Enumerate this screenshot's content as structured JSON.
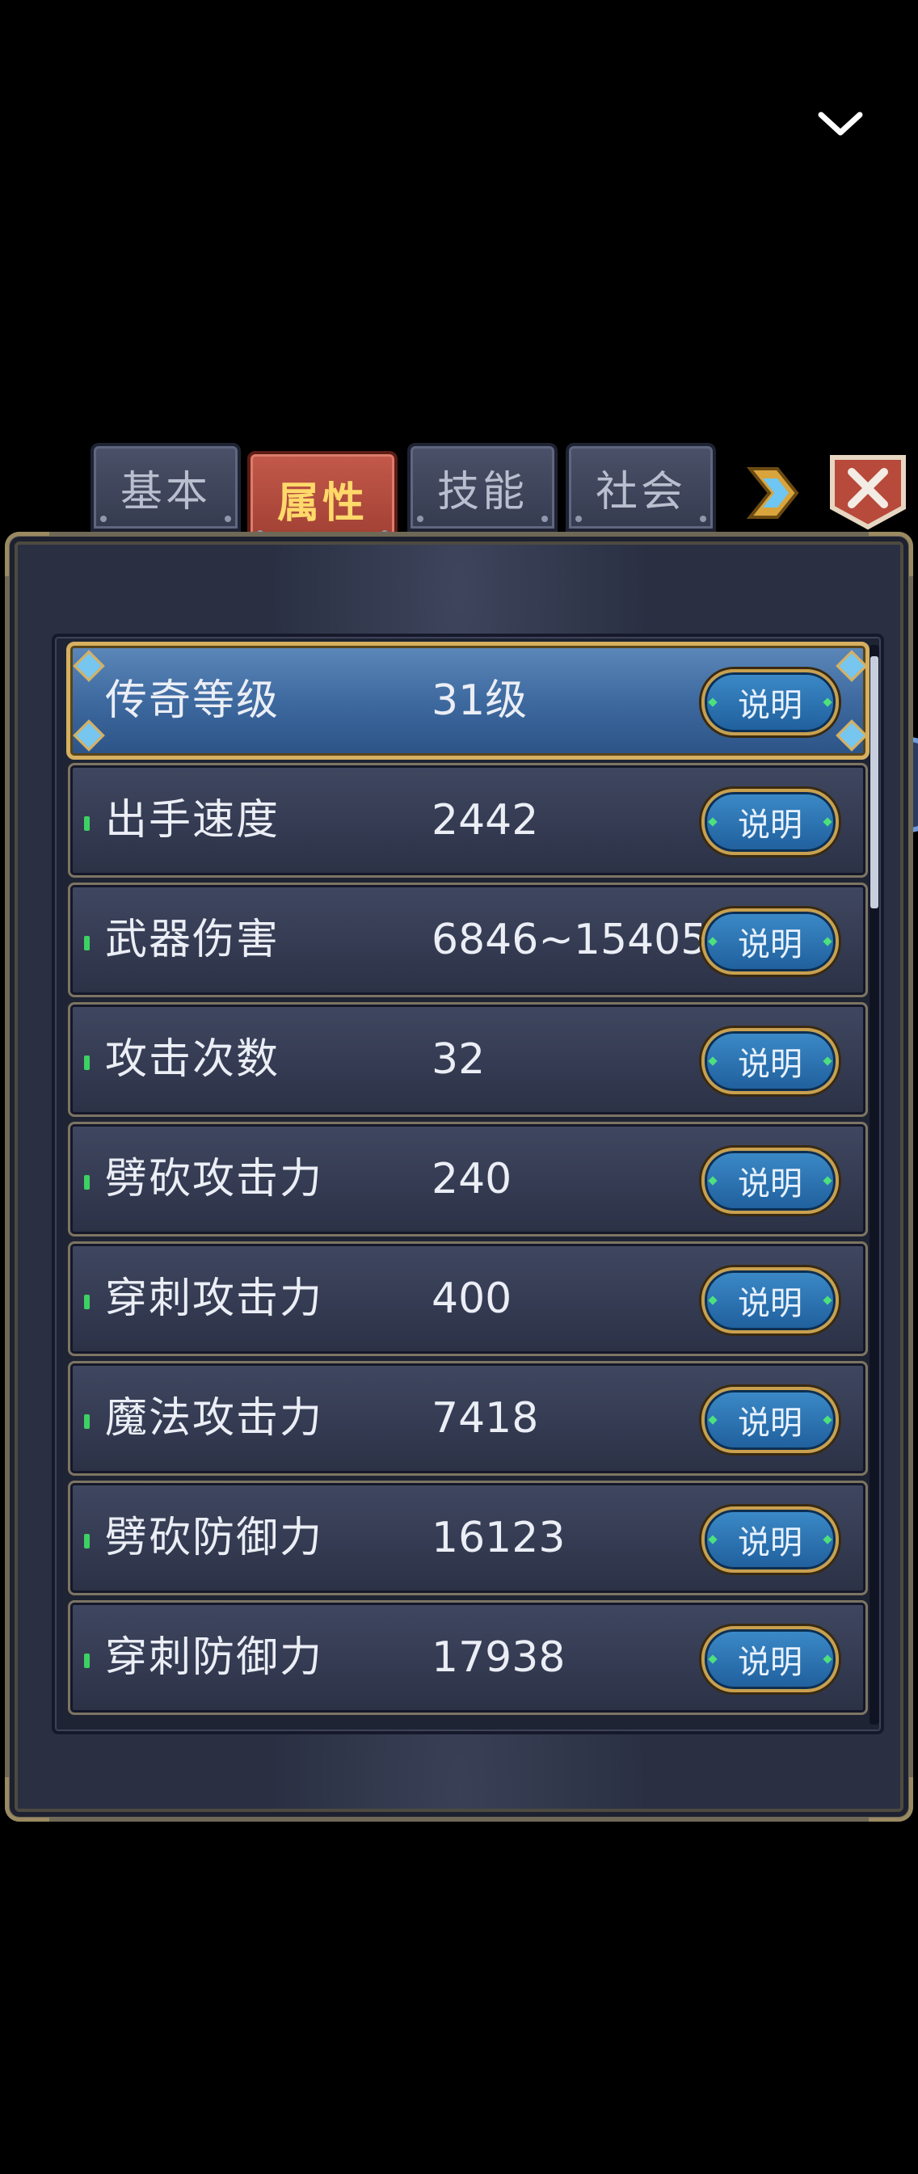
{
  "tabs": [
    {
      "label": "基本",
      "active": false
    },
    {
      "label": "属性",
      "active": true
    },
    {
      "label": "技能",
      "active": false
    },
    {
      "label": "社会",
      "active": false
    }
  ],
  "info_button_label": "说明",
  "rows": [
    {
      "label": "传奇等级",
      "value": "31级",
      "selected": true
    },
    {
      "label": "出手速度",
      "value": "2442",
      "selected": false
    },
    {
      "label": "武器伤害",
      "value": "6846~15405",
      "selected": false
    },
    {
      "label": "攻击次数",
      "value": "32",
      "selected": false
    },
    {
      "label": "劈砍攻击力",
      "value": "240",
      "selected": false
    },
    {
      "label": "穿刺攻击力",
      "value": "400",
      "selected": false
    },
    {
      "label": "魔法攻击力",
      "value": "7418",
      "selected": false
    },
    {
      "label": "劈砍防御力",
      "value": "16123",
      "selected": false
    },
    {
      "label": "穿刺防御力",
      "value": "17938",
      "selected": false
    }
  ],
  "colors": {
    "active_tab": "#b34a3d",
    "active_tab_text": "#ffd96a",
    "selected_row": "#3e6aa0",
    "row_bg": "#343b52",
    "bullet": "#3dd163",
    "info_button": "#2d73b3",
    "frame_gold": "#d6b061"
  },
  "icons": {
    "collapse": "chevron-down-icon",
    "next_tab": "arrow-right-icon",
    "close": "close-icon"
  }
}
